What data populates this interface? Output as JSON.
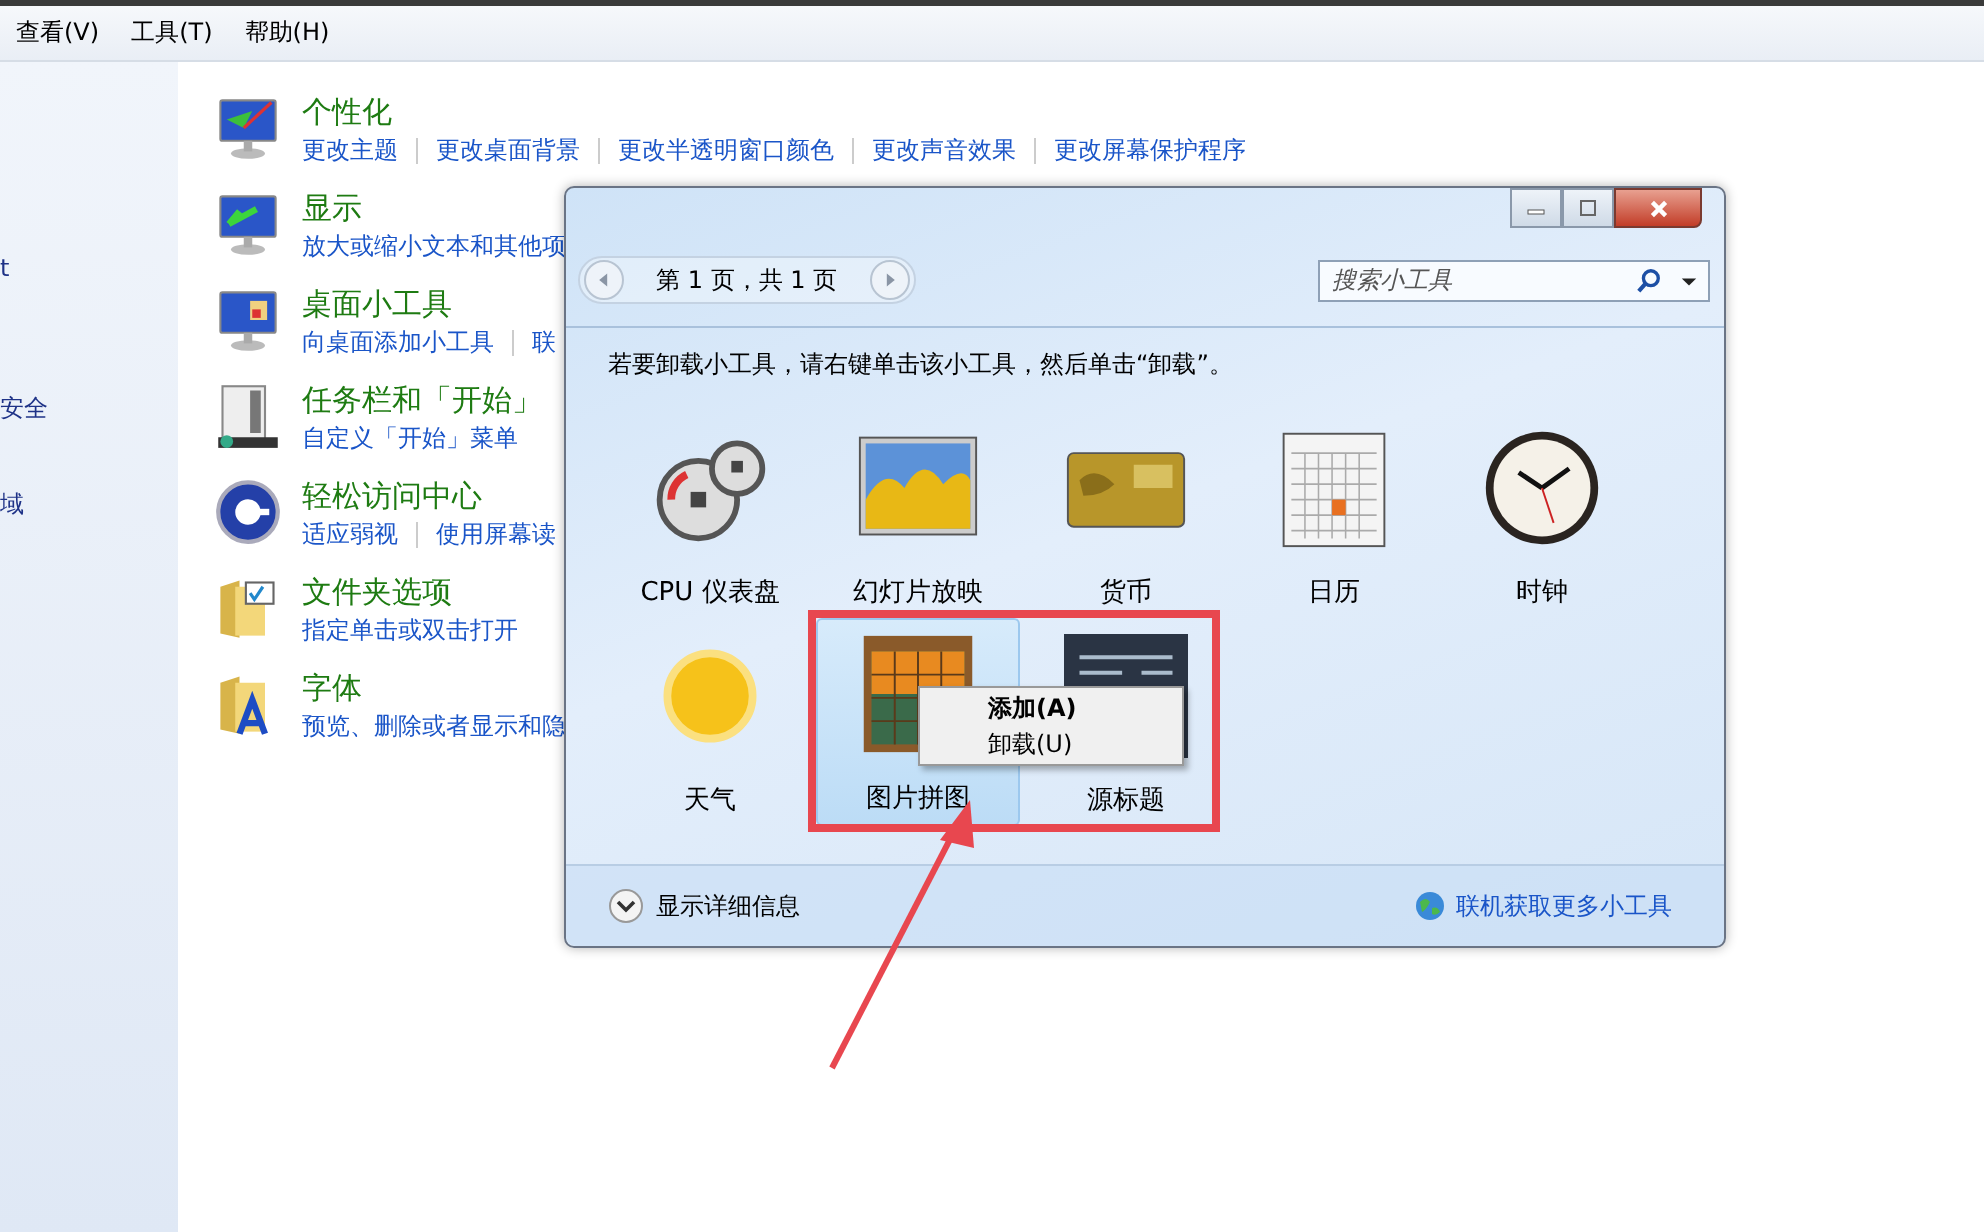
{
  "menu_bar": [
    {
      "label": "查看(V)"
    },
    {
      "label": "工具(T)"
    },
    {
      "label": "帮助(H)"
    }
  ],
  "sidebar": [
    {
      "label": "t"
    },
    {
      "label": "安全"
    },
    {
      "label": "域"
    }
  ],
  "categories": [
    {
      "kind": "personalize",
      "title": "个性化",
      "links": [
        "更改主题",
        "更改桌面背景",
        "更改半透明窗口颜色",
        "更改声音效果",
        "更改屏幕保护程序"
      ]
    },
    {
      "kind": "display",
      "title": "显示",
      "links": [
        "放大或缩小文本和其他项"
      ]
    },
    {
      "kind": "gadgets",
      "title": "桌面小工具",
      "links": [
        "向桌面添加小工具",
        "联"
      ]
    },
    {
      "kind": "taskbar",
      "title": "任务栏和「开始」",
      "links": [
        "自定义「开始」菜单"
      ]
    },
    {
      "kind": "access",
      "title": "轻松访问中心",
      "links": [
        "适应弱视",
        "使用屏幕读"
      ]
    },
    {
      "kind": "folder",
      "title": "文件夹选项",
      "links": [
        "指定单击或双击打开"
      ]
    },
    {
      "kind": "fonts",
      "title": "字体",
      "links": [
        "预览、删除或者显示和隐"
      ]
    }
  ],
  "dialog": {
    "pager": "第 1 页，共 1 页",
    "search": {
      "placeholder": "搜索小工具"
    },
    "instruction": "若要卸载小工具，请右键单击该小工具，然后单击“卸载”。",
    "gadgets": [
      {
        "kind": "cpu",
        "name": "CPU 仪表盘",
        "selected": false
      },
      {
        "kind": "slideshow",
        "name": "幻灯片放映",
        "selected": false
      },
      {
        "kind": "currency",
        "name": "货币",
        "selected": false
      },
      {
        "kind": "calendar",
        "name": "日历",
        "selected": false
      },
      {
        "kind": "clock",
        "name": "时钟",
        "selected": false
      },
      {
        "kind": "weather",
        "name": "天气",
        "selected": false
      },
      {
        "kind": "puzzle",
        "name": "图片拼图",
        "selected": true
      },
      {
        "kind": "feed",
        "name": "源标题",
        "selected": false
      }
    ],
    "context_menu": [
      {
        "label": "添加(A)",
        "default": true
      },
      {
        "label": "卸载(U)",
        "default": false
      }
    ],
    "details": "显示详细信息",
    "online_link": "联机获取更多小工具"
  }
}
